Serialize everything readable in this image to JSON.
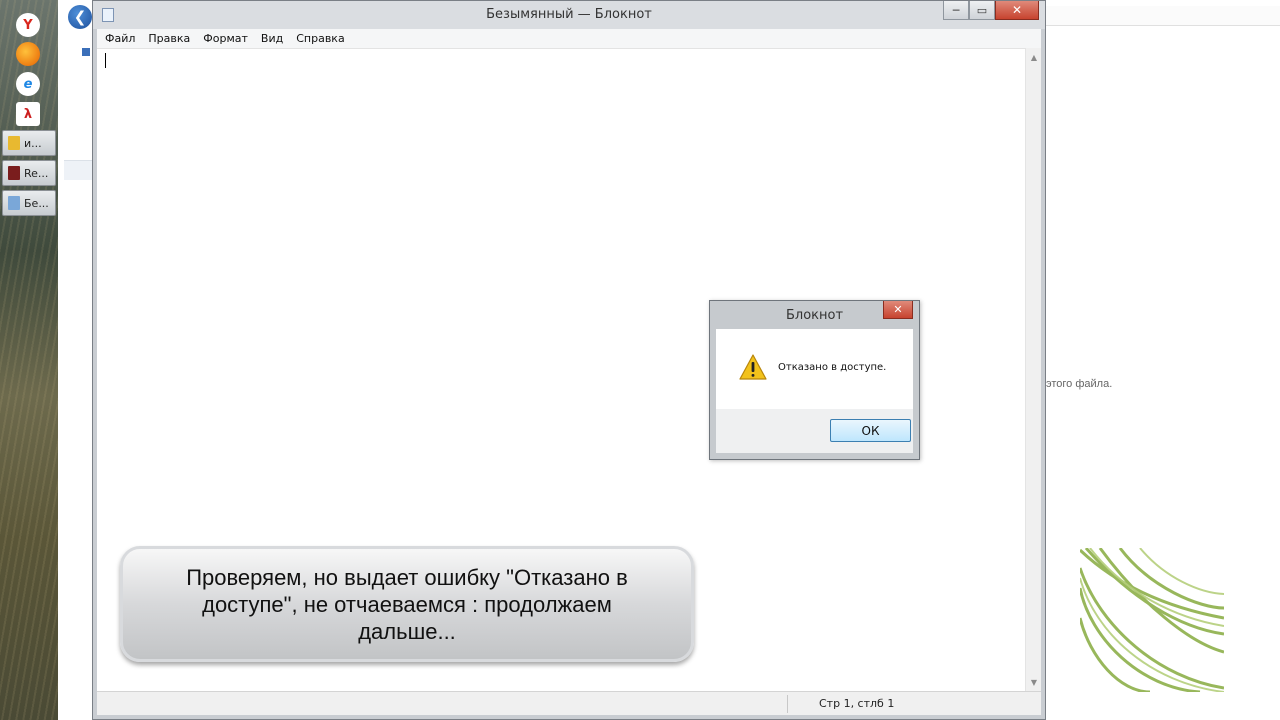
{
  "taskbar": {
    "pinned": [
      {
        "icon": "yandex-browser-icon",
        "color": "#d9261c"
      },
      {
        "icon": "firefox-icon",
        "color": "#e66000"
      },
      {
        "icon": "internet-explorer-icon",
        "color": "#1e88e5"
      },
      {
        "icon": "acrobat-icon",
        "color": "#cc1f1f"
      }
    ],
    "windows": [
      {
        "label": "и...",
        "icon": "folder-icon",
        "color": "#e8b930"
      },
      {
        "label": "Re...",
        "icon": "registry-editor-icon",
        "color": "#7a1d1d"
      },
      {
        "label": "Бе...",
        "icon": "notepad-icon",
        "color": "#7aa7d8"
      }
    ]
  },
  "background": {
    "partial_text": "этого файла."
  },
  "notepad": {
    "title": "Безымянный — Блокнот",
    "controls": {
      "minimize": "─",
      "maximize": "▭",
      "close": "✕"
    },
    "menu": [
      "Файл",
      "Правка",
      "Формат",
      "Вид",
      "Справка"
    ],
    "content": "",
    "status": "Стр 1, стлб 1"
  },
  "dialog": {
    "title": "Блокнот",
    "close": "✕",
    "message": "Отказано в доступе.",
    "ok_label": "ОК",
    "icon": "warning-icon"
  },
  "caption": {
    "text": "Проверяем, но выдает ошибку \"Отказано в доступе\", не отчаеваемся : продолжаем дальше..."
  },
  "colors": {
    "accent_close": "#c7432f",
    "ok_button_border": "#3c7fb1",
    "warning_yellow": "#f2c21b"
  }
}
